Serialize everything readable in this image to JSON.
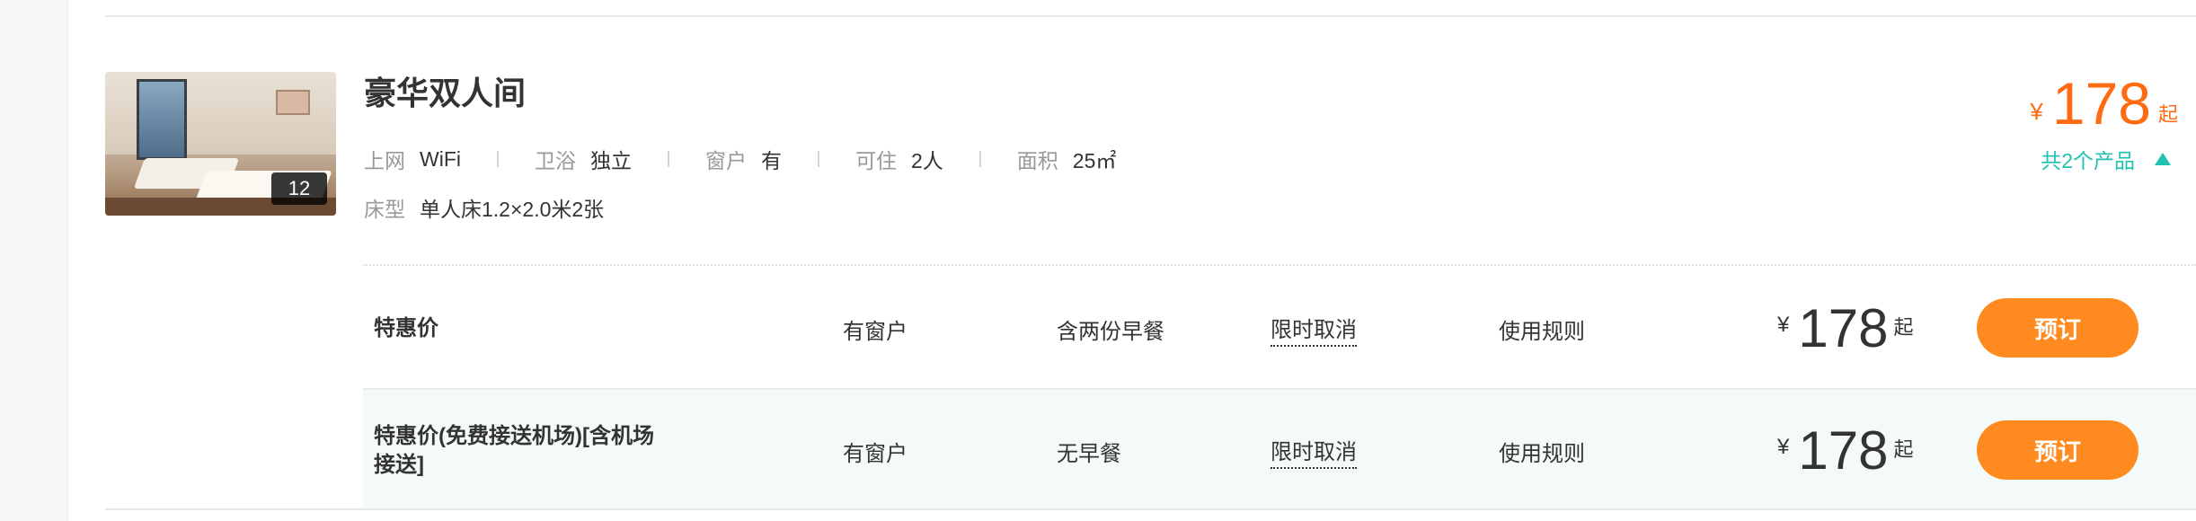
{
  "room": {
    "title": "豪华双人间",
    "photo_count": "12",
    "amenities": [
      {
        "label": "上网",
        "value": "WiFi"
      },
      {
        "label": "卫浴",
        "value": "独立"
      },
      {
        "label": "窗户",
        "value": "有"
      },
      {
        "label": "可住",
        "value": "2人"
      },
      {
        "label": "面积",
        "value": "25㎡"
      }
    ],
    "bed": {
      "label": "床型",
      "value": "单人床1.2×2.0米2张"
    },
    "price": {
      "currency": "¥",
      "amount": "178",
      "suffix": "起"
    },
    "product_count": "共2个产品"
  },
  "products": [
    {
      "name": "特惠价",
      "window": "有窗户",
      "breakfast": "含两份早餐",
      "cancel": "限时取消",
      "rules": "使用规则",
      "currency": "¥",
      "price": "178",
      "suffix": "起",
      "book_label": "预订"
    },
    {
      "name": "特惠价(免费接送机场)[含机场\n接送]",
      "window": "有窗户",
      "breakfast": "无早餐",
      "cancel": "限时取消",
      "rules": "使用规则",
      "currency": "¥",
      "price": "178",
      "suffix": "起",
      "book_label": "预订"
    }
  ],
  "colors": {
    "price_orange": "#ff6b12",
    "button_orange": "#ff8a1f",
    "accent_teal": "#1fc2b0",
    "row_highlight": "#f3faf9"
  },
  "icons": {
    "expand_toggle": "triangle-up-icon"
  }
}
